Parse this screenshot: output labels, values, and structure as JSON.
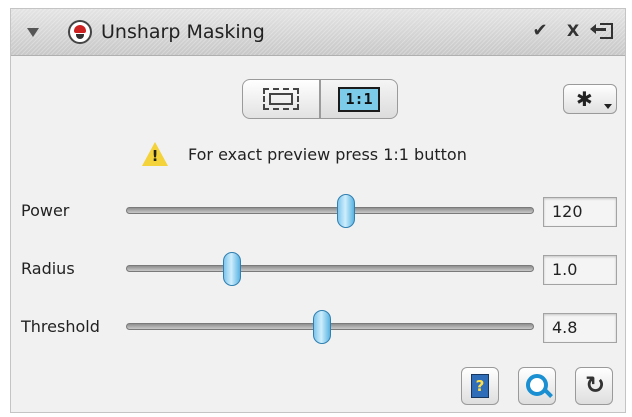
{
  "window": {
    "title": "Unsharp Masking",
    "ok_glyph": "✔",
    "close_glyph": "X"
  },
  "preview": {
    "one_to_one_label": "1:1",
    "selected": "1:1",
    "warning_text": "For exact preview press 1:1 button",
    "warning_glyph": "!"
  },
  "settings": {
    "gear_glyph": "✱"
  },
  "params": [
    {
      "label": "Power",
      "value": "120",
      "level": 0.54
    },
    {
      "label": "Radius",
      "value": "1.0",
      "level": 0.26
    },
    {
      "label": "Threshold",
      "value": "4.8",
      "level": 0.48
    }
  ],
  "footer": {
    "help_glyph": "?",
    "reset_glyph": "↻"
  },
  "colors": {
    "accent": "#7ccbe8",
    "slider_thumb": "#5ab3e3",
    "warning": "#f3d23a"
  }
}
